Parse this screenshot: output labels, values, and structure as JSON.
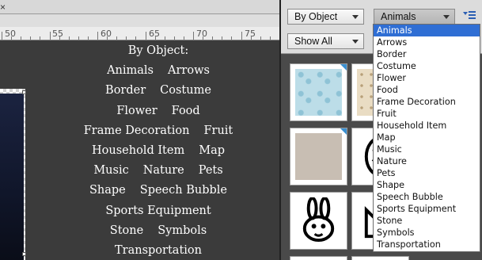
{
  "canvas": {
    "close_glyph": "×",
    "ruler_labels": [
      "50",
      "55",
      "60",
      "65",
      "70",
      "75"
    ],
    "overlay_rows": [
      [
        "By Object:"
      ],
      [
        "Animals",
        "Arrows"
      ],
      [
        "Border",
        "Costume"
      ],
      [
        "Flower",
        "Food"
      ],
      [
        "Frame Decoration",
        "Fruit"
      ],
      [
        "Household Item",
        "Map"
      ],
      [
        "Music",
        "Nature",
        "Pets"
      ],
      [
        "Shape",
        "Speech Bubble"
      ],
      [
        "Sports Equipment"
      ],
      [
        "Stone",
        "Symbols"
      ],
      [
        "Transportation"
      ]
    ]
  },
  "panel": {
    "filter_label": "By Object",
    "show_label": "Show All",
    "category_label": "Animals",
    "menu_icon": "panel-options-icon",
    "thumbnails": [
      {
        "kind": "paw-pattern",
        "badge": true
      },
      {
        "kind": "beige-pattern",
        "badge": true
      },
      {
        "kind": "taupe-texture",
        "badge": true
      },
      {
        "kind": "penguin-shape",
        "badge": false
      },
      {
        "kind": "rabbit-shape",
        "badge": false
      },
      {
        "kind": "cat-shape",
        "badge": false
      }
    ]
  },
  "dropdown": {
    "selected_index": 0,
    "options": [
      "Animals",
      "Arrows",
      "Border",
      "Costume",
      "Flower",
      "Food",
      "Frame Decoration",
      "Fruit",
      "Household Item",
      "Map",
      "Music",
      "Nature",
      "Pets",
      "Shape",
      "Speech Bubble",
      "Sports Equipment",
      "Stone",
      "Symbols",
      "Transportation"
    ]
  },
  "colors": {
    "selection": "#2f6ed4",
    "badge": "#3a8fd0",
    "canvas_bg": "#3b3b3b"
  }
}
